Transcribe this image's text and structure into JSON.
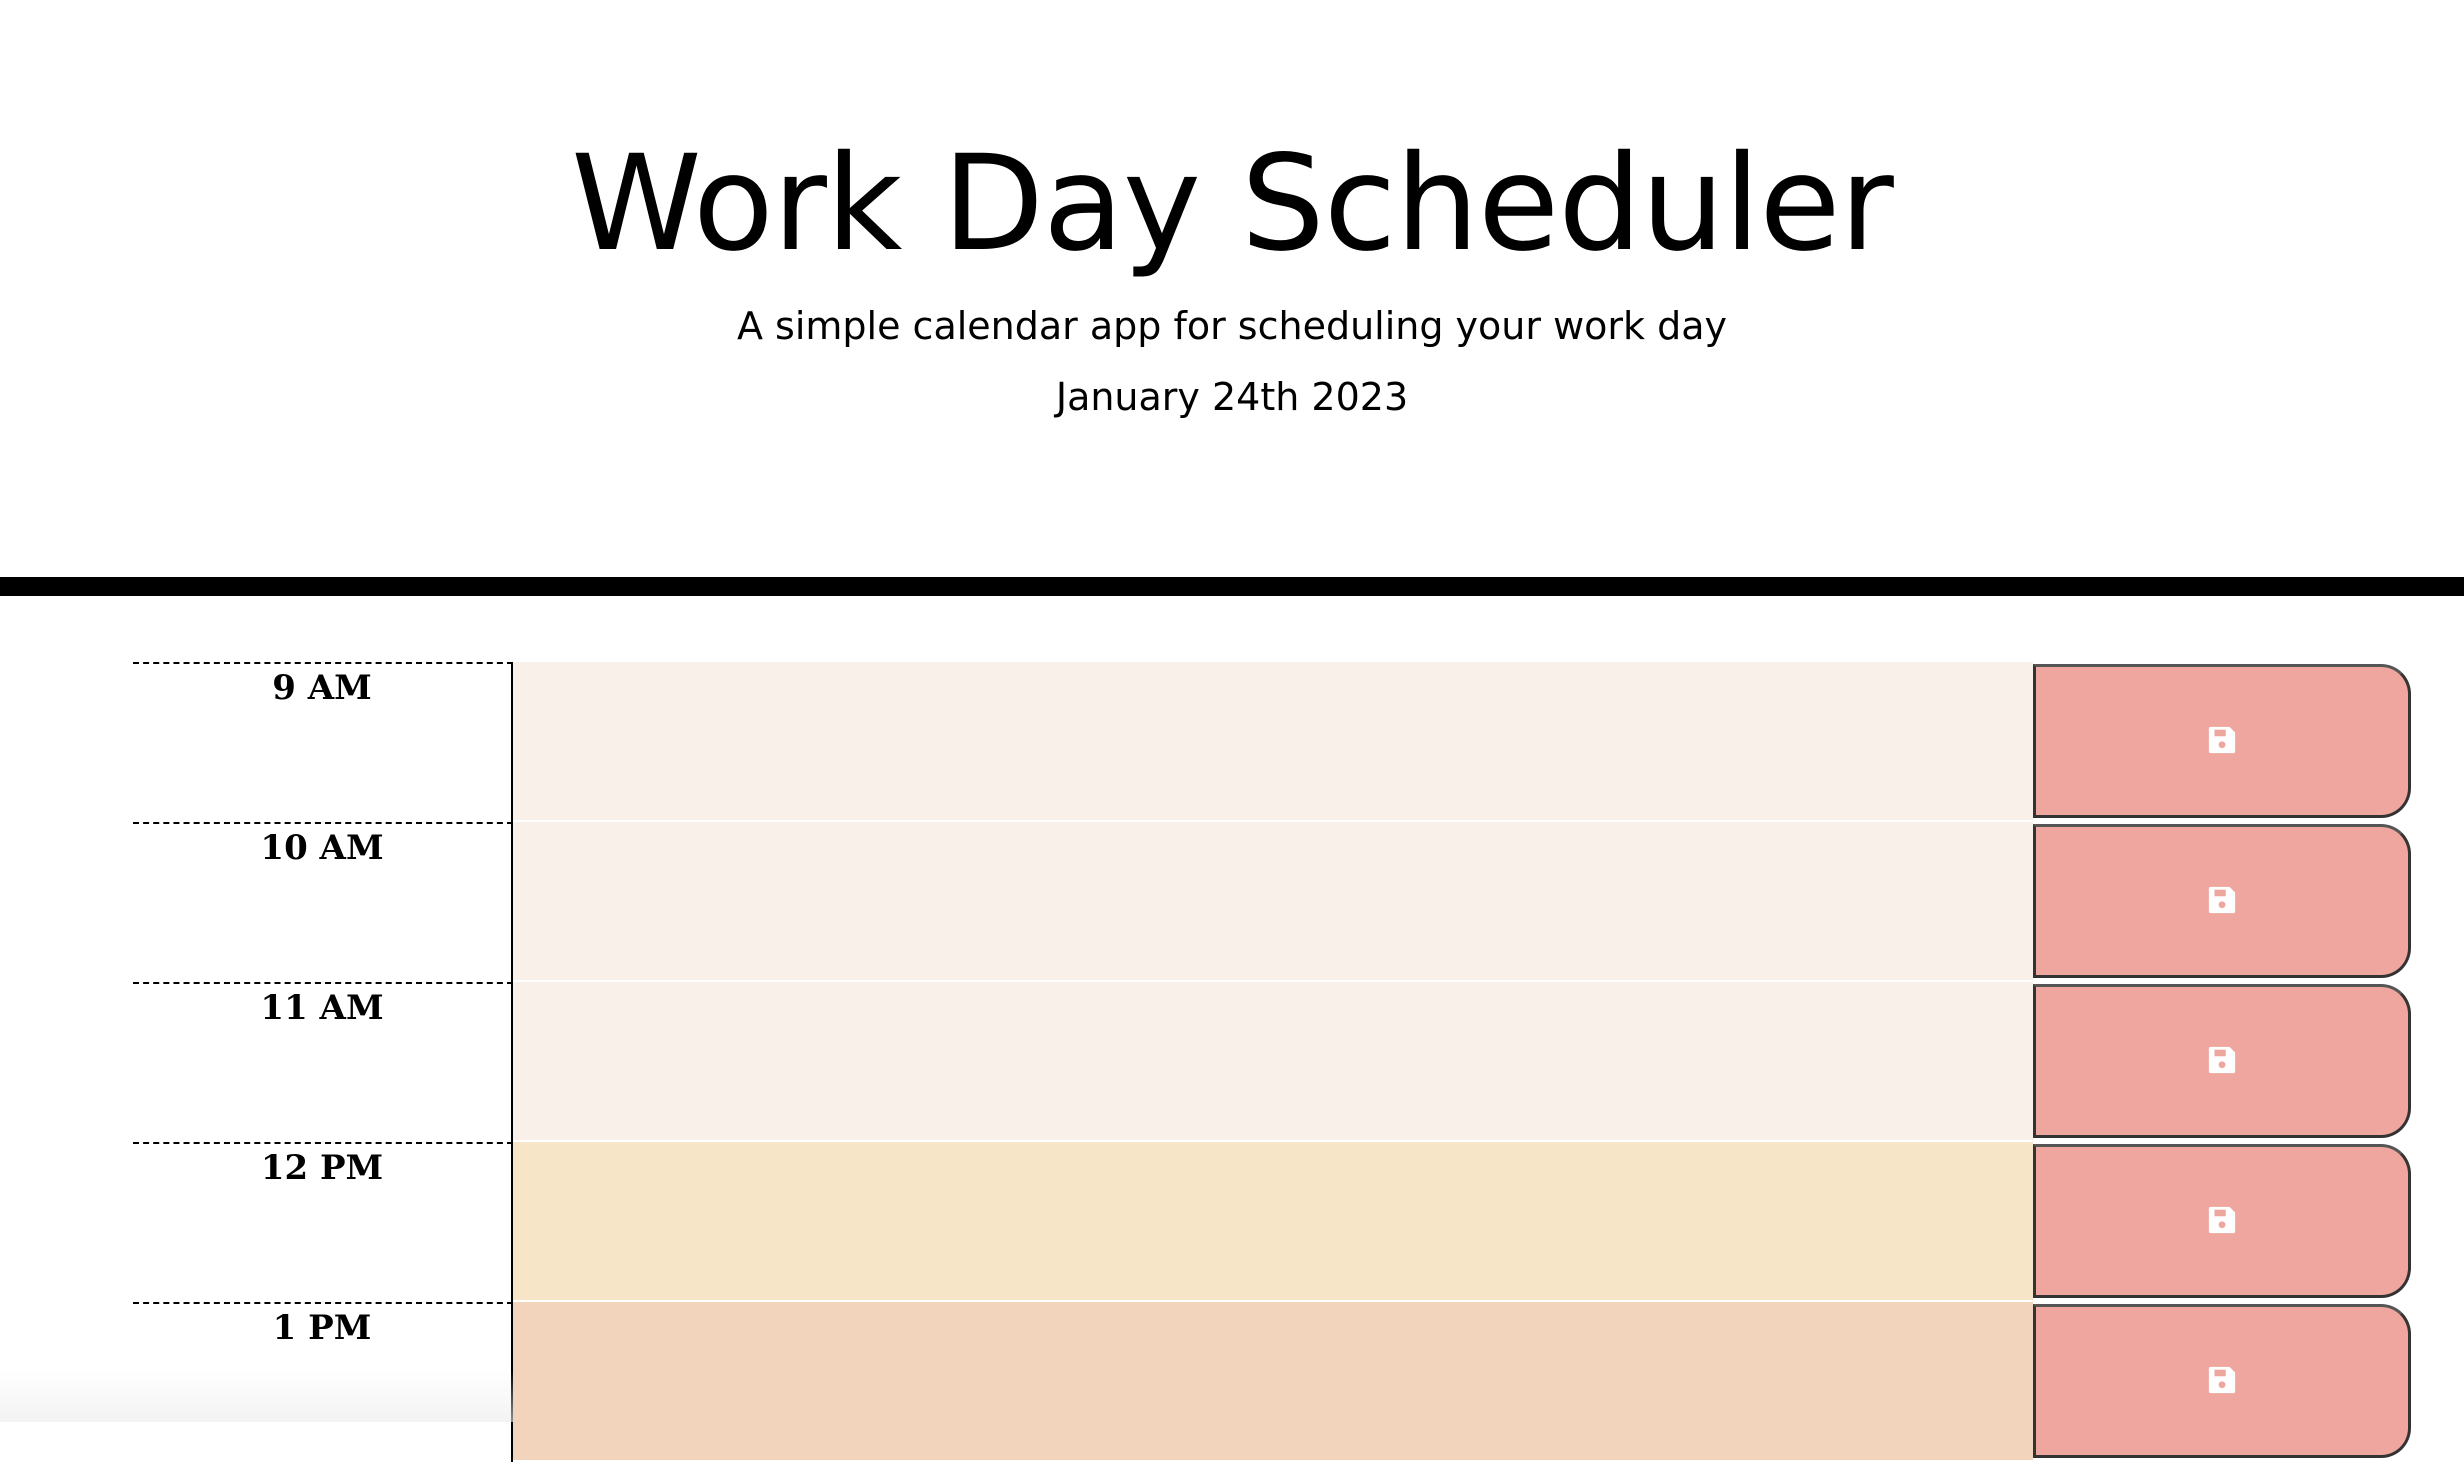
{
  "header": {
    "title": "Work Day Scheduler",
    "subtitle": "A simple calendar app for scheduling your work day",
    "current_date": "January 24th 2023"
  },
  "colors": {
    "past": "#faf0ea",
    "present": "#f7e5c8",
    "future": "#f2d4bd",
    "save_button": "#eea69e",
    "icon": "#ffffff"
  },
  "timeblocks": [
    {
      "hour_label": "9 AM",
      "status": "past",
      "text": "",
      "save_icon": "floppy-disk-icon"
    },
    {
      "hour_label": "10 AM",
      "status": "past",
      "text": "",
      "save_icon": "floppy-disk-icon"
    },
    {
      "hour_label": "11 AM",
      "status": "past",
      "text": "",
      "save_icon": "floppy-disk-icon"
    },
    {
      "hour_label": "12 PM",
      "status": "present",
      "text": "",
      "save_icon": "floppy-disk-icon"
    },
    {
      "hour_label": "1 PM",
      "status": "future",
      "text": "",
      "save_icon": "floppy-disk-icon"
    }
  ]
}
